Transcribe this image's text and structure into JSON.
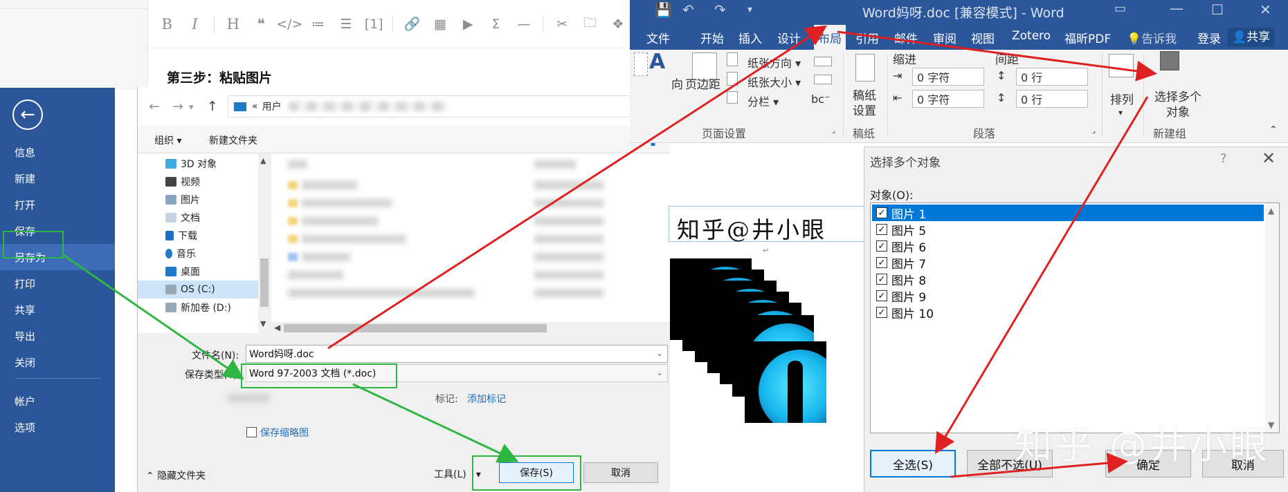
{
  "md_editor": {
    "toolbar": [
      "B",
      "I",
      "H",
      "❝",
      "</>",
      "≔",
      "☰",
      "[1]",
      "🔗",
      "▦",
      "▶",
      "Σ",
      "—",
      "✂",
      "🗀",
      "❖"
    ],
    "heading": "第三步：粘贴图片"
  },
  "backstage": {
    "back_glyph": "←",
    "items": [
      "信息",
      "新建",
      "打开",
      "保存",
      "另存为",
      "打印",
      "共享",
      "导出",
      "关闭",
      "帐户",
      "选项"
    ],
    "active": "另存为"
  },
  "save_dialog": {
    "address_prefix": "«",
    "address_text": "用户",
    "organize": "组织 ▾",
    "new_folder": "新建文件夹",
    "nav_items": [
      "3D 对象",
      "视频",
      "图片",
      "文档",
      "下载",
      "音乐",
      "桌面",
      "OS (C:)",
      "新加卷 (D:)"
    ],
    "nav_selected": "OS (C:)",
    "filename_label": "文件名(N):",
    "filename_value": "Word妈呀.doc",
    "filetype_label": "保存类型(T):",
    "filetype_value": "Word 97-2003 文档 (*.doc)",
    "tags_label": "标记:",
    "tags_link": "添加标记",
    "thumbnail_label": "保存缩略图",
    "hide_folders": "隐藏文件夹",
    "tools": "工具(L)",
    "save_button": "保存(S)",
    "cancel_button": "取消"
  },
  "word": {
    "title": "Word妈呀.doc [兼容模式] - Word",
    "qat": {
      "save": "💾",
      "undo": "↶",
      "redo": "↷",
      "more": "▾"
    },
    "window_controls": [
      "▭",
      "—",
      "☐",
      "✕"
    ],
    "tabs": [
      "文件",
      "开始",
      "插入",
      "设计",
      "布局",
      "引用",
      "邮件",
      "审阅",
      "视图",
      "Zotero",
      "福昕PDF"
    ],
    "active_tab": "布局",
    "tell_me": "告诉我",
    "signin": "登录",
    "share": "共享",
    "ribbon": {
      "text_direction": "向",
      "margins": "页边距",
      "orientation": "纸张方向 ▾",
      "size": "纸张大小 ▾",
      "columns": "分栏 ▾",
      "page_setup_group": "页面设置",
      "draft_paper": "稿纸设置",
      "draft_group": "稿纸",
      "indent_label": "缩进",
      "spacing_label": "间距",
      "indent_left": "0 字符",
      "indent_right": "0 字符",
      "space_before": "0 行",
      "space_after": "0 行",
      "paragraph_group": "段落",
      "arrange": "排列",
      "select_objects": "选择多个对象",
      "new_group": "新建组"
    }
  },
  "document": {
    "text": "知乎@井小眼",
    "image_count": 7
  },
  "select_pane": {
    "title": "选择多个对象",
    "help": "?",
    "close": "✕",
    "objects_label": "对象(O):",
    "items": [
      {
        "name": "图片 1",
        "checked": true,
        "highlighted": true
      },
      {
        "name": "图片 5",
        "checked": true,
        "highlighted": false
      },
      {
        "name": "图片 6",
        "checked": true,
        "highlighted": false
      },
      {
        "name": "图片 7",
        "checked": true,
        "highlighted": false
      },
      {
        "name": "图片 8",
        "checked": true,
        "highlighted": false
      },
      {
        "name": "图片 9",
        "checked": true,
        "highlighted": false
      },
      {
        "name": "图片 10",
        "checked": true,
        "highlighted": false
      }
    ],
    "select_all": "全选(S)",
    "deselect_all": "全部不选(U)",
    "ok": "确定",
    "cancel": "取消"
  },
  "watermark": "知乎 @井小眼",
  "colors": {
    "word_blue": "#2b579a",
    "annotation_green": "#2db642",
    "annotation_red": "#e02020",
    "selection_blue": "#0078d7"
  }
}
